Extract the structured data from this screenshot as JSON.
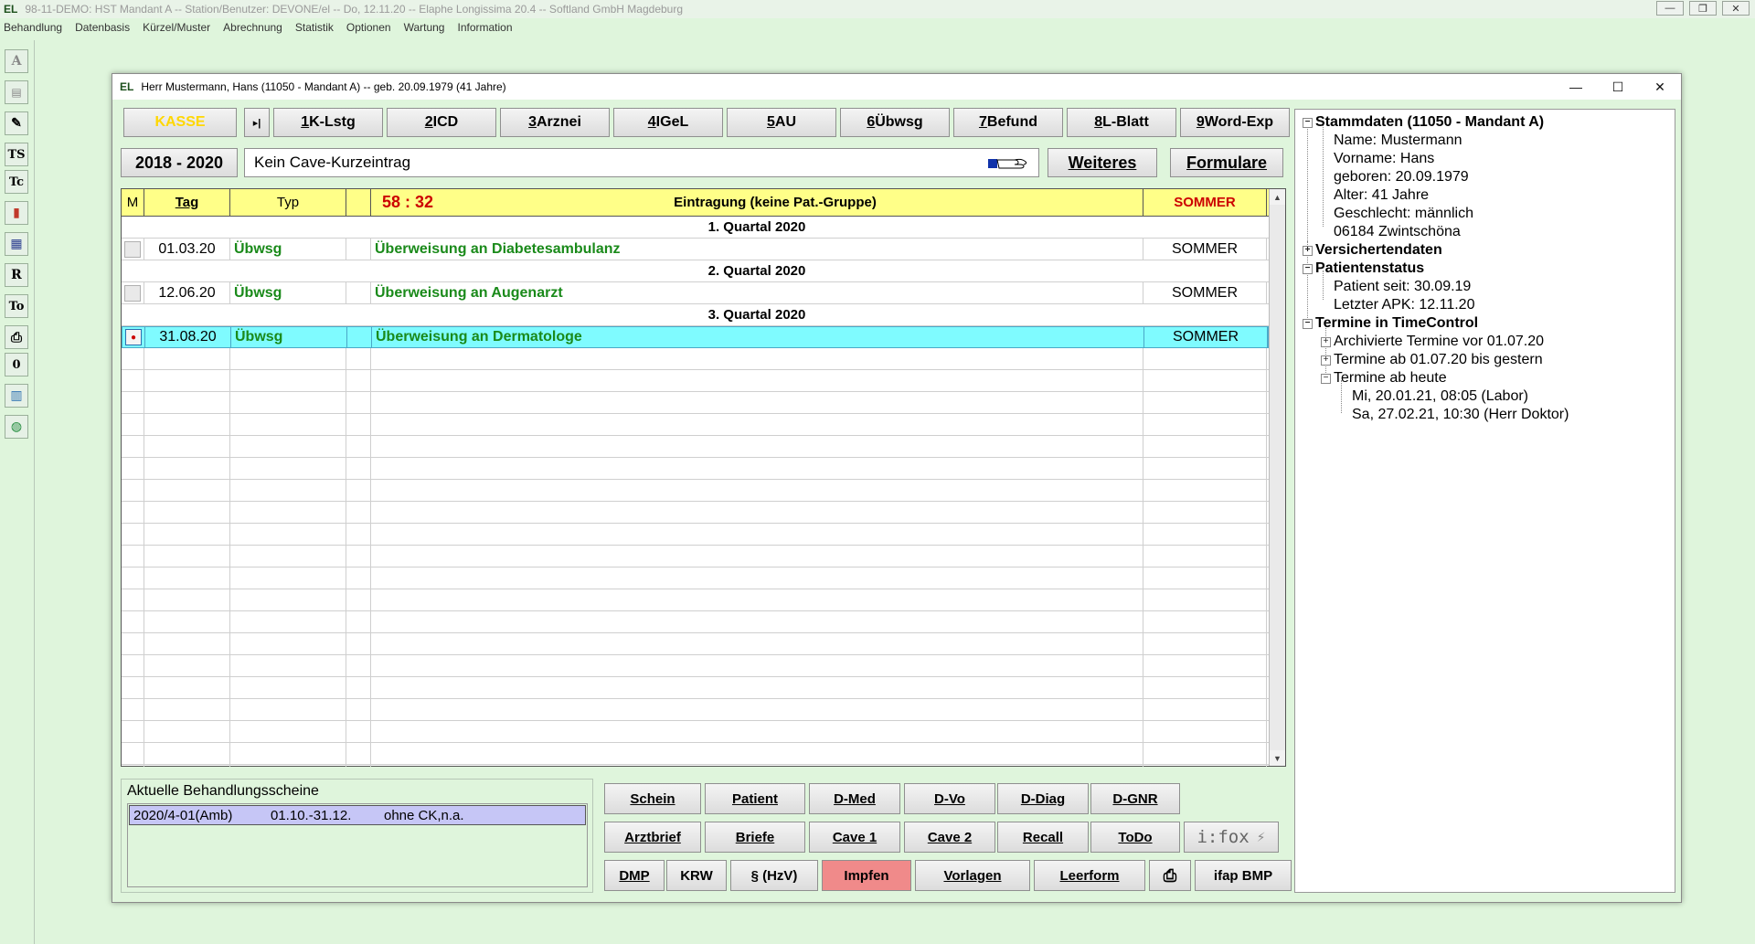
{
  "app": {
    "title": "98-11-DEMO: HST Mandant A -- Station/Benutzer: DEVONE/el -- Do, 12.11.20 -- Elaphe Longissima 20.4 -- Softland GmbH Magdeburg",
    "logo": "EL",
    "menu": [
      "Behandlung",
      "Datenbasis",
      "Kürzel/Muster",
      "Abrechnung",
      "Statistik",
      "Optionen",
      "Wartung",
      "Information"
    ],
    "toolbar": [
      "A",
      "▤",
      "✎",
      "TS",
      "Tc",
      "▮",
      "▦",
      "R",
      "To",
      "⎙",
      "0",
      "▥",
      "◍"
    ]
  },
  "window": {
    "title": "Herr Mustermann, Hans (11050 - Mandant A) -- geb. 20.09.1979 (41 Jahre)",
    "logo": "EL",
    "controls": [
      "—",
      "☐",
      "✕"
    ]
  },
  "topbar": {
    "kasse": "KASSE",
    "nav": "▸|",
    "tabs": [
      {
        "key": "1",
        "label": " K-Lstg"
      },
      {
        "key": "2",
        "label": " ICD"
      },
      {
        "key": "3",
        "label": " Arznei"
      },
      {
        "key": "4",
        "label": " IGeL"
      },
      {
        "key": "5",
        "label": " AU"
      },
      {
        "key": "6",
        "label": " Übwsg"
      },
      {
        "key": "7",
        "label": " Befund"
      },
      {
        "key": "8",
        "label": " L-Blatt"
      },
      {
        "key": "9",
        "label": " Word-Exp"
      }
    ]
  },
  "secondbar": {
    "years": "2018 - 2020",
    "cave": "Kein Cave-Kurzeintrag",
    "weiteres": "Weiteres",
    "formulare": "Formulare"
  },
  "grid": {
    "headers": {
      "m": "M",
      "tag": "Tag",
      "typ": "Typ",
      "time": "58 : 32",
      "eintrag": "Eintragung (keine Pat.-Gruppe)",
      "user": "SOMMER"
    },
    "rows": [
      {
        "kind": "quarter",
        "text": "1. Quartal 2020"
      },
      {
        "kind": "entry",
        "date": "01.03.20",
        "typ": "Übwsg",
        "text": "Überweisung an Diabetesambulanz",
        "user": "SOMMER"
      },
      {
        "kind": "quarter",
        "text": "2. Quartal 2020"
      },
      {
        "kind": "entry",
        "date": "12.06.20",
        "typ": "Übwsg",
        "text": "Überweisung an Augenarzt",
        "user": "SOMMER"
      },
      {
        "kind": "quarter",
        "text": "3. Quartal 2020"
      },
      {
        "kind": "entry",
        "date": "31.08.20",
        "typ": "Übwsg",
        "text": "Überweisung an Dermatologe",
        "user": "SOMMER",
        "selected": true
      }
    ]
  },
  "scheine": {
    "label": "Aktuelle Behandlungsscheine",
    "items": [
      {
        "id": "2020/4-01(Amb)",
        "range": "01.10.-31.12.",
        "note": "ohne CK,n.a."
      }
    ]
  },
  "actions": {
    "row1": [
      "Schein",
      "Patient",
      "D-Med",
      "D-Vo",
      "D-Diag",
      "D-GNR"
    ],
    "row2": [
      "Arztbrief",
      "Briefe",
      "Cave 1",
      "Cave 2",
      "Recall",
      "ToDo"
    ],
    "row3": [
      "DMP",
      "KRW",
      "§ (HzV)",
      "Impfen",
      "Vorlagen",
      "Leerform",
      "ifap BMP"
    ],
    "ifox": "i:fox"
  },
  "tree": [
    {
      "text": "Stammdaten (11050 - Mandant A)",
      "level": 0,
      "bold": true,
      "sign": "−"
    },
    {
      "text": "Name: Mustermann",
      "level": 1
    },
    {
      "text": "Vorname: Hans",
      "level": 1
    },
    {
      "text": "geboren: 20.09.1979",
      "level": 1
    },
    {
      "text": "Alter: 41 Jahre",
      "level": 1
    },
    {
      "text": "Geschlecht: männlich",
      "level": 1
    },
    {
      "text": "06184 Zwintschöna",
      "level": 1
    },
    {
      "text": "Versichertendaten",
      "level": 0,
      "bold": true,
      "sign": "+"
    },
    {
      "text": "Patientenstatus",
      "level": 0,
      "bold": true,
      "sign": "−"
    },
    {
      "text": "Patient seit: 30.09.19",
      "level": 1
    },
    {
      "text": "Letzter APK: 12.11.20",
      "level": 1
    },
    {
      "text": "Termine in TimeControl",
      "level": 0,
      "bold": true,
      "sign": "−"
    },
    {
      "text": "Archivierte Termine vor 01.07.20",
      "level": 1,
      "sign": "+"
    },
    {
      "text": "Termine ab 01.07.20 bis gestern",
      "level": 1,
      "sign": "+"
    },
    {
      "text": "Termine ab heute",
      "level": 1,
      "sign": "−"
    },
    {
      "text": "Mi, 20.01.21, 08:05 (Labor)",
      "level": 2
    },
    {
      "text": "Sa, 27.02.21, 10:30 (Herr Doktor)",
      "level": 2
    }
  ],
  "colors": {
    "kasse": "#ffd700",
    "header_bg": "#ffff88",
    "time": "#cc0000",
    "selected_row": "#7ffbff",
    "entry_green": "#1a8a1a",
    "impfen": "#f08a8a"
  }
}
